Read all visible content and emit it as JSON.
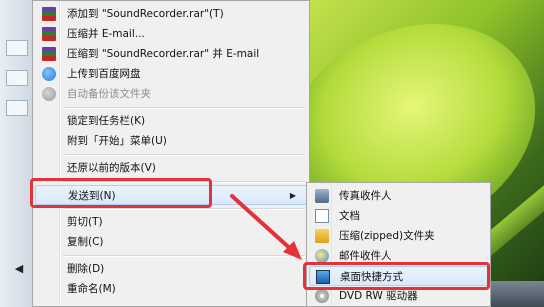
{
  "context_menu": {
    "items": [
      {
        "label": "添加到 \"SoundRecorder.rar\"(T)",
        "icon": "winrar-icon",
        "disabled": false
      },
      {
        "label": "压缩并 E-mail...",
        "icon": "winrar-icon",
        "disabled": false
      },
      {
        "label": "压缩到 \"SoundRecorder.rar\" 并 E-mail",
        "icon": "winrar-icon",
        "disabled": false
      },
      {
        "label": "上传到百度网盘",
        "icon": "baidu-cloud-icon",
        "disabled": false
      },
      {
        "label": "自动备份该文件夹",
        "icon": "baidu-backup-icon",
        "disabled": true
      },
      {
        "label": "锁定到任务栏(K)",
        "icon": "",
        "disabled": false
      },
      {
        "label": "附到「开始」菜单(U)",
        "icon": "",
        "disabled": false
      },
      {
        "label": "还原以前的版本(V)",
        "icon": "",
        "disabled": false
      },
      {
        "label": "发送到(N)",
        "icon": "",
        "disabled": false
      },
      {
        "label": "剪切(T)",
        "icon": "",
        "disabled": false
      },
      {
        "label": "复制(C)",
        "icon": "",
        "disabled": false
      },
      {
        "label": "删除(D)",
        "icon": "",
        "disabled": false
      },
      {
        "label": "重命名(M)",
        "icon": "",
        "disabled": false
      }
    ],
    "submenu_arrow": "▶"
  },
  "send_to_menu": {
    "items": [
      {
        "label": "传真收件人",
        "icon": "fax-icon"
      },
      {
        "label": "文档",
        "icon": "document-icon"
      },
      {
        "label": "压缩(zipped)文件夹",
        "icon": "zip-folder-icon"
      },
      {
        "label": "邮件收件人",
        "icon": "mail-icon"
      },
      {
        "label": "桌面快捷方式",
        "icon": "desktop-icon"
      },
      {
        "label": "DVD RW 驱动器",
        "icon": "dvd-icon"
      }
    ]
  },
  "colors": {
    "highlight_box": "#e5323a",
    "menu_background": "#f0f0f0"
  },
  "left_strip": {
    "scroll_arrow": "◀"
  }
}
